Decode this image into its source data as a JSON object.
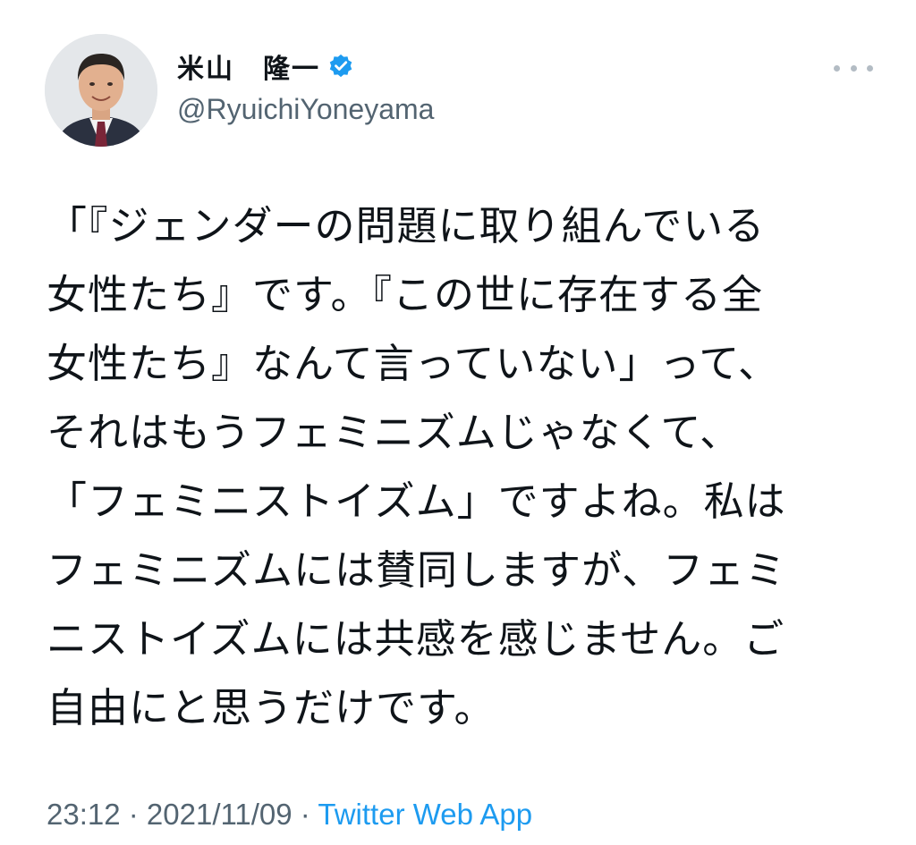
{
  "author": {
    "display_name": "米山　隆一",
    "handle": "@RyuichiYoneyama",
    "verified": true,
    "avatar_icon": "profile-photo-man-in-suit"
  },
  "more_icon": "ellipsis-icon",
  "tweet": {
    "lines": [
      "「『ジェンダーの問題に取り組んでいる",
      "女性たち』です。『この世に存在する全",
      "女性たち』なんて言っていない」って、",
      "それはもうフェミニズムじゃなくて、",
      "「フェミニストイズム」ですよね。私は",
      "フェミニズムには賛同しますが、フェミ",
      "ニストイズムには共感を感じません。ご",
      "自由にと思うだけです。"
    ]
  },
  "meta": {
    "time": "23:12",
    "separator": " · ",
    "date": "2021/11/09",
    "source": "Twitter Web App"
  },
  "colors": {
    "text": "#0f1419",
    "secondary": "#536471",
    "accent": "#1d9bf0"
  }
}
